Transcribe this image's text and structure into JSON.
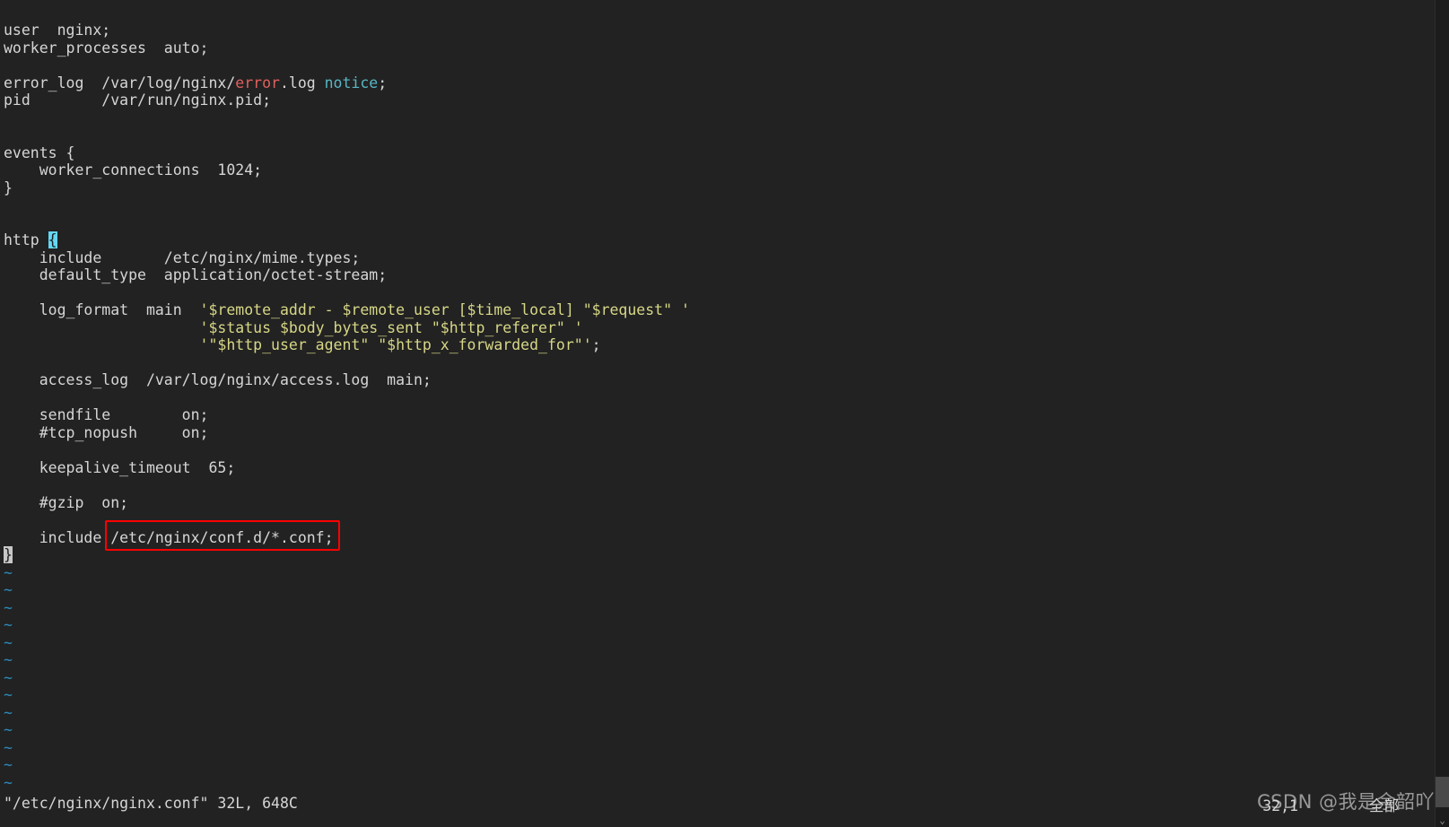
{
  "editor": {
    "name": "vim",
    "background_color": "#222222",
    "foreground_color": "#d6d6d6",
    "cursor_color": "#63d7f5",
    "tilde_color": "#2b8bbb",
    "string_color": "#d7d787",
    "keyword_red": "#e0615f",
    "keyword_cyan": "#58b6c4"
  },
  "file": {
    "path": "/etc/nginx/nginx.conf",
    "lines": "32L",
    "chars": "648C"
  },
  "statusline": {
    "text": "\"/etc/nginx/nginx.conf\" 32L, 648C",
    "ruler": "32,1",
    "position_label": "全部"
  },
  "buffer": {
    "lines": [
      {
        "n": 1,
        "segments": [
          {
            "t": "user  nginx;"
          }
        ]
      },
      {
        "n": 2,
        "segments": [
          {
            "t": "worker_processes  auto;"
          }
        ]
      },
      {
        "n": 3,
        "segments": [
          {
            "t": ""
          }
        ]
      },
      {
        "n": 4,
        "segments": [
          {
            "t": "error_log  /var/log/nginx/"
          },
          {
            "t": "error",
            "c": "red"
          },
          {
            "t": ".log "
          },
          {
            "t": "notice",
            "c": "cyan"
          },
          {
            "t": ";"
          }
        ]
      },
      {
        "n": 5,
        "segments": [
          {
            "t": "pid        /var/run/nginx.pid;"
          }
        ]
      },
      {
        "n": 6,
        "segments": [
          {
            "t": ""
          }
        ]
      },
      {
        "n": 7,
        "segments": [
          {
            "t": ""
          }
        ]
      },
      {
        "n": 8,
        "segments": [
          {
            "t": "events {"
          }
        ]
      },
      {
        "n": 9,
        "segments": [
          {
            "t": "    worker_connections  1024;"
          }
        ]
      },
      {
        "n": 10,
        "segments": [
          {
            "t": "}"
          }
        ]
      },
      {
        "n": 11,
        "segments": [
          {
            "t": ""
          }
        ]
      },
      {
        "n": 12,
        "segments": [
          {
            "t": ""
          }
        ]
      },
      {
        "n": 13,
        "segments": [
          {
            "t": "http "
          },
          {
            "t": "{",
            "c": "cursor"
          }
        ]
      },
      {
        "n": 14,
        "segments": [
          {
            "t": "    include       /etc/nginx/mime.types;"
          }
        ]
      },
      {
        "n": 15,
        "segments": [
          {
            "t": "    default_type  application/octet-stream;"
          }
        ]
      },
      {
        "n": 16,
        "segments": [
          {
            "t": ""
          }
        ]
      },
      {
        "n": 17,
        "segments": [
          {
            "t": "    log_format  main  "
          },
          {
            "t": "'$remote_addr - $remote_user [$time_local] \"$request\" '",
            "c": "str"
          }
        ]
      },
      {
        "n": 18,
        "segments": [
          {
            "t": "                      "
          },
          {
            "t": "'$status $body_bytes_sent \"$http_referer\" '",
            "c": "str"
          }
        ]
      },
      {
        "n": 19,
        "segments": [
          {
            "t": "                      "
          },
          {
            "t": "'\"$http_user_agent\" \"$http_x_forwarded_for\"'",
            "c": "str"
          },
          {
            "t": ";"
          }
        ]
      },
      {
        "n": 20,
        "segments": [
          {
            "t": ""
          }
        ]
      },
      {
        "n": 21,
        "segments": [
          {
            "t": "    access_log  /var/log/nginx/access.log  main;"
          }
        ]
      },
      {
        "n": 22,
        "segments": [
          {
            "t": ""
          }
        ]
      },
      {
        "n": 23,
        "segments": [
          {
            "t": "    sendfile        on;"
          }
        ]
      },
      {
        "n": 24,
        "segments": [
          {
            "t": "    #tcp_nopush     on;"
          }
        ]
      },
      {
        "n": 25,
        "segments": [
          {
            "t": ""
          }
        ]
      },
      {
        "n": 26,
        "segments": [
          {
            "t": "    keepalive_timeout  65;"
          }
        ]
      },
      {
        "n": 27,
        "segments": [
          {
            "t": ""
          }
        ]
      },
      {
        "n": 28,
        "segments": [
          {
            "t": "    #gzip  on;"
          }
        ]
      },
      {
        "n": 29,
        "segments": [
          {
            "t": ""
          }
        ]
      },
      {
        "n": 30,
        "segments": [
          {
            "t": "    include /etc/nginx/conf.d/*.conf;"
          }
        ]
      },
      {
        "n": 31,
        "segments": [
          {
            "t": "}",
            "c": "brace-match"
          }
        ]
      }
    ],
    "tilde_rows": 13,
    "tilde_char": "~"
  },
  "annotation": {
    "label": "include-path-highlight",
    "color": "#ff0000",
    "target_text": "/etc/nginx/conf.d/*.conf;"
  },
  "watermark": {
    "text": "CSDN @我是余韶吖"
  },
  "scrollbar": {
    "arrow_glyph": "⌄"
  }
}
